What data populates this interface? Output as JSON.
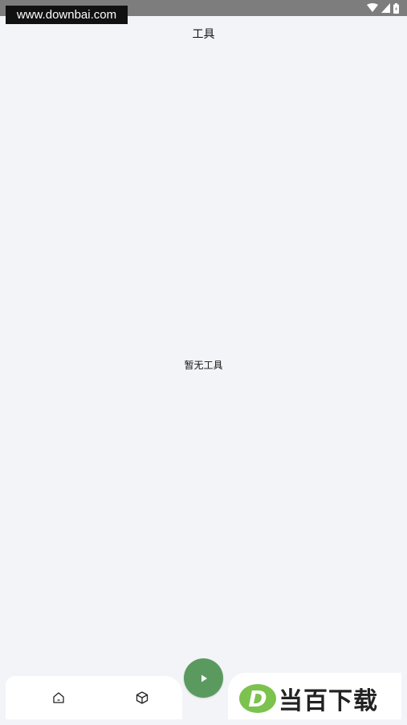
{
  "watermark": {
    "url": "www.downbai.com",
    "logo_text": "当百下载",
    "logo_letter": "D"
  },
  "header": {
    "title": "工具"
  },
  "main": {
    "empty_message": "暂无工具"
  },
  "nav": {
    "items": [
      {
        "icon": "home-icon"
      },
      {
        "icon": "cube-icon"
      }
    ],
    "fab_icon": "play-icon"
  },
  "colors": {
    "background": "#f3f4f8",
    "fab": "#5b9a5f",
    "status_bar": "#7d7d7d",
    "logo_green": "#7cc24e"
  }
}
